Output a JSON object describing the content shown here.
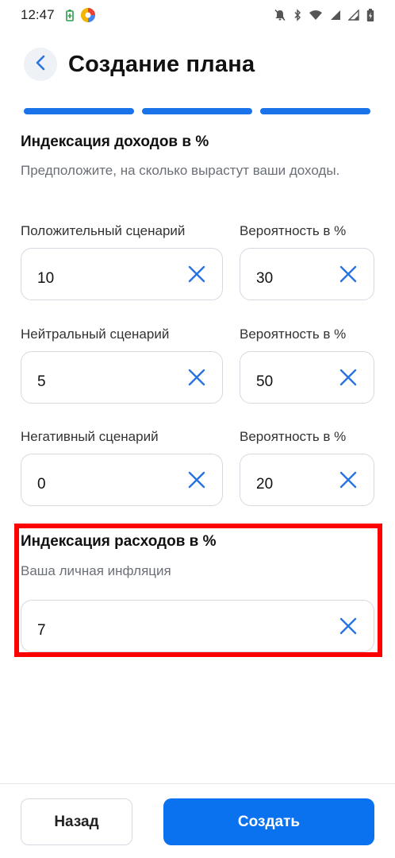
{
  "status_bar": {
    "time": "12:47",
    "icons": [
      "battery-saver-icon",
      "app-icon",
      "mute-icon",
      "bluetooth-icon",
      "wifi-icon",
      "signal-icon",
      "signal-icon",
      "battery-icon"
    ]
  },
  "header": {
    "title": "Создание плана",
    "back_icon": "chevron-left-icon"
  },
  "steps": {
    "total": 3,
    "active": 3
  },
  "income_section": {
    "title": "Индексация доходов в %",
    "description": "Предположите, на сколько вырастут ваши доходы.",
    "scenarios": [
      {
        "label": "Положительный сценарий",
        "value": "10",
        "prob_label": "Вероятность в %",
        "prob_value": "30"
      },
      {
        "label": "Нейтральный сценарий",
        "value": "5",
        "prob_label": "Вероятность в %",
        "prob_value": "50"
      },
      {
        "label": "Негативный сценарий",
        "value": "0",
        "prob_label": "Вероятность в %",
        "prob_value": "20"
      }
    ]
  },
  "expense_section": {
    "title": "Индексация расходов в %",
    "description": "Ваша личная инфляция",
    "value": "7"
  },
  "footer": {
    "back_label": "Назад",
    "create_label": "Создать"
  },
  "colors": {
    "accent": "#0a72ee",
    "progress": "#1a73e8",
    "highlight": "#ff0000",
    "clear_icon": "#2a73e0"
  }
}
